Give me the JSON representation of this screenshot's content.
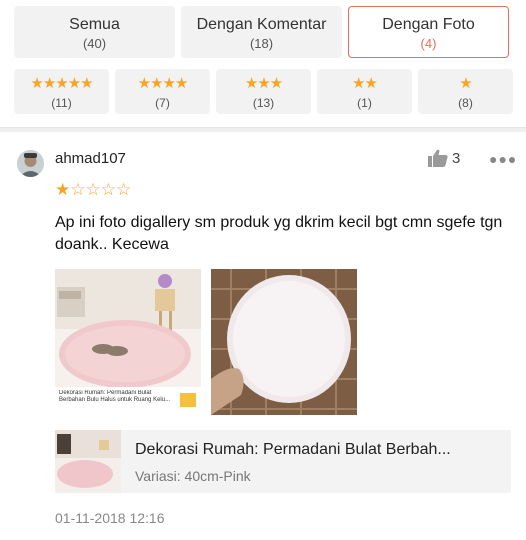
{
  "filters": {
    "tabs": [
      {
        "label": "Semua",
        "count": "(40)"
      },
      {
        "label": "Dengan Komentar",
        "count": "(18)"
      },
      {
        "label": "Dengan Foto",
        "count": "(4)"
      }
    ],
    "star_filters": [
      {
        "stars": "★★★★★",
        "count": "(11)"
      },
      {
        "stars": "★★★★",
        "count": "(7)"
      },
      {
        "stars": "★★★",
        "count": "(13)"
      },
      {
        "stars": "★★",
        "count": "(1)"
      },
      {
        "stars": "★",
        "count": "(8)"
      }
    ]
  },
  "review": {
    "username": "ahmad107",
    "likes": "3",
    "rating": 1,
    "rating_max": 5,
    "text": "Ap ini foto digallery sm produk yg dkrim kecil bgt cmn sgefe tgn doank.. Kecewa",
    "photo1_caption": "Dekorasi Rumah: Permadani Bulat Berbahan Bulu Halus untuk Ruang Kelu...",
    "product": {
      "name": "Dekorasi Rumah: Permadani Bulat Berbah...",
      "variant": "Variasi: 40cm-Pink"
    },
    "date": "01-11-2018 12:16"
  },
  "colors": {
    "accent": "#e0705a",
    "star": "#f6a623"
  }
}
